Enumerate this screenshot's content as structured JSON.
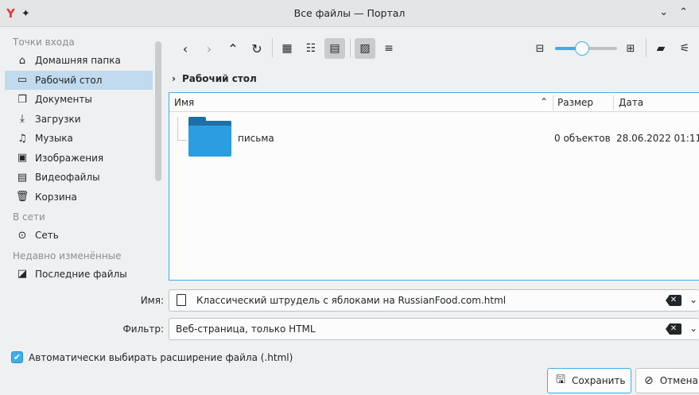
{
  "window": {
    "title": "Все файлы — Портал",
    "app_icon": "Y",
    "icons": {
      "pin": "pin-icon",
      "minimize": "chevron-down-icon",
      "maximize": "chevron-up-icon"
    }
  },
  "sidebar": {
    "sections": [
      {
        "title": "Точки входа",
        "items": [
          {
            "label": "Домашняя папка",
            "icon": "home-icon"
          },
          {
            "label": "Рабочий стол",
            "icon": "desktop-icon",
            "active": true
          },
          {
            "label": "Документы",
            "icon": "documents-icon"
          },
          {
            "label": "Загрузки",
            "icon": "downloads-icon"
          },
          {
            "label": "Музыка",
            "icon": "music-icon"
          },
          {
            "label": "Изображения",
            "icon": "images-icon"
          },
          {
            "label": "Видеофайлы",
            "icon": "videos-icon"
          },
          {
            "label": "Корзина",
            "icon": "trash-icon"
          }
        ]
      },
      {
        "title": "В сети",
        "items": [
          {
            "label": "Сеть",
            "icon": "network-icon"
          }
        ]
      },
      {
        "title": "Недавно изменённые",
        "items": [
          {
            "label": "Последние файлы",
            "icon": "recent-files-icon"
          }
        ]
      }
    ]
  },
  "toolbar": {
    "buttons": [
      "back-icon",
      "forward-icon",
      "up-icon",
      "reload-icon",
      "icons-view-icon",
      "compact-view-icon",
      "detailed-view-icon",
      "preview-icon",
      "sort-icon",
      "zoom-out-icon",
      "zoom-in-icon",
      "new-folder-icon",
      "options-icon"
    ],
    "zoom_level": 0.44
  },
  "breadcrumb": {
    "current": "Рабочий стол"
  },
  "file_list": {
    "columns": {
      "name": "Имя",
      "size": "Размер",
      "date": "Дата"
    },
    "rows": [
      {
        "name": "письма",
        "size": "0 объектов",
        "date": "28.06.2022 01:11",
        "type": "folder"
      }
    ]
  },
  "name_field": {
    "label": "Имя:",
    "value": "Классический штрудель с яблоками на RussianFood.com.html"
  },
  "filter_field": {
    "label": "Фильтр:",
    "value": "Веб-страница, только HTML"
  },
  "auto_extension": {
    "label": "Автоматически выбирать расширение файла (.html)",
    "checked": true
  },
  "buttons": {
    "save": "Сохранить",
    "cancel": "Отмена"
  },
  "colors": {
    "accent": "#3daee9",
    "selection": "#c2daef",
    "folder": "#2a9ee0",
    "app_icon": "#e8363c"
  }
}
